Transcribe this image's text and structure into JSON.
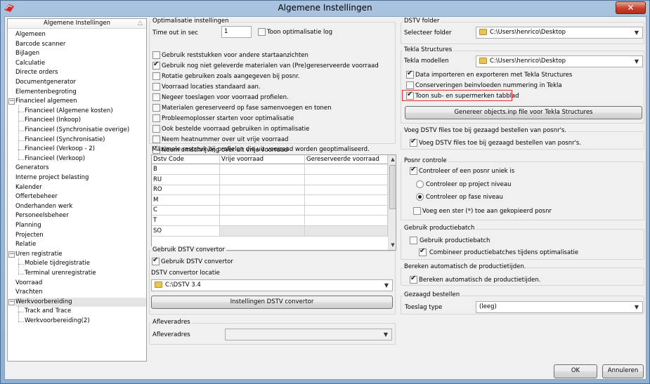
{
  "window": {
    "title": "Algemene Instellingen",
    "close": "✕"
  },
  "tree": {
    "header": "Algemene Instellingen",
    "items": [
      {
        "label": "Algemeen"
      },
      {
        "label": "Barcode scanner"
      },
      {
        "label": "Bijlagen"
      },
      {
        "label": "Calculatie"
      },
      {
        "label": "Directe orders"
      },
      {
        "label": "Documentgenerator"
      },
      {
        "label": "Elementenbegroting"
      },
      {
        "label": "Financieel algemeen"
      },
      {
        "label": "Financieel (Algemene kosten)"
      },
      {
        "label": "Financieel (Inkoop)"
      },
      {
        "label": "Financieel (Synchronisatie overige)"
      },
      {
        "label": "Financieel (Synchronisatie)"
      },
      {
        "label": "Financieel (Verkoop - 2)"
      },
      {
        "label": "Financieel (Verkoop)"
      },
      {
        "label": "Generators"
      },
      {
        "label": "Interne project belasting"
      },
      {
        "label": "Kalender"
      },
      {
        "label": "Offertebeheer"
      },
      {
        "label": "Onderhanden werk"
      },
      {
        "label": "Personeelsbeheer"
      },
      {
        "label": "Planning"
      },
      {
        "label": "Projecten"
      },
      {
        "label": "Relatie"
      },
      {
        "label": "Uren registratie"
      },
      {
        "label": "Mobiele tijdregistratie"
      },
      {
        "label": "Terminal urenregistratie"
      },
      {
        "label": "Voorraad"
      },
      {
        "label": "Vrachten"
      },
      {
        "label": "Werkvoorbereiding"
      },
      {
        "label": "Track and Trace"
      },
      {
        "label": "Werkvoorbereiding(2)"
      }
    ]
  },
  "opt": {
    "group": "Optimalisatie instellingen",
    "timeout_label": "Time out in sec",
    "timeout_value": "1",
    "log_label": "Toon optimalisatie log",
    "checks": [
      {
        "label": "Gebruik reststukken voor andere startaanzichten",
        "checked": false
      },
      {
        "label": "Gebruik nog niet geleverde materialen van (Pre)gereserveerde voorraad",
        "checked": true
      },
      {
        "label": "Rotatie gebruiken zoals aangegeven bij posnr.",
        "checked": false
      },
      {
        "label": "Voorraad locaties standaard aan.",
        "checked": false
      },
      {
        "label": "Negeer toeslagen voor voorraad profielen.",
        "checked": false
      },
      {
        "label": "Materialen gereserveerd op fase samenvoegen en tonen",
        "checked": false
      },
      {
        "label": "Probleemoplosser starten voor optimalisatie",
        "checked": false
      },
      {
        "label": "Ook bestelde voorraad gebruiken in optimalisatie",
        "checked": false
      },
      {
        "label": "Neem heatnummer over uit vrije voorraad",
        "checked": false
      },
      {
        "label": "Neem omschrijving over uit vrije voorraad",
        "checked": false
      }
    ]
  },
  "grid": {
    "title": "Maximale reststuk bij profielen die uit voorraad worden geoptimaliseerd.",
    "columns": [
      "Dstv Code",
      "Vrije voorraad",
      "Gereserveerde voorraad"
    ],
    "rows": [
      "B",
      "RU",
      "RO",
      "M",
      "C",
      "T",
      "SO"
    ]
  },
  "dstvconv": {
    "group": "Gebruik DSTV convertor",
    "use_label": "Gebruik DSTV convertor",
    "loc_label": "DSTV convertor locatie",
    "loc_value": "C:\\DSTV 3.4",
    "button": "Instellingen DSTV convertor"
  },
  "afl": {
    "group": "Afleveradres",
    "label": "Afleveradres",
    "value": ""
  },
  "dstvfolder": {
    "group": "DSTV folder",
    "label": "Selecteer folder",
    "value": "C:\\Users\\henrico\\Desktop"
  },
  "tekla": {
    "group": "Tekla Structures",
    "label": "Tekla modellen",
    "value": "C:\\Users\\henrico\\Desktop",
    "checks": [
      {
        "label": "Data importeren en exporteren met Tekla Structures",
        "checked": true
      },
      {
        "label": "Conserveringen beinvloeden nummering in Tekla",
        "checked": false
      },
      {
        "label": "Toon sub- en supermerken tabblad",
        "checked": true
      }
    ],
    "button": "Genereer objects.inp file voor Tekla Structures"
  },
  "voeg": {
    "group": "Voeg DSTV files toe bij gezaagd bestellen van posnr's.",
    "label": "Voeg DSTV files toe bij gezaagd bestellen van posnr's."
  },
  "posnr": {
    "group": "Posnr controle",
    "check": "Controleer of een posnr uniek is",
    "radio1": "Controleer op project niveau",
    "radio2": "Controleer op fase niveau",
    "star": "Voeg een ster (*) toe aan gekopieerd posnr"
  },
  "batch": {
    "group": "Gebruik productiebatch",
    "check1": "Gebruik productiebatch",
    "check2": "Combineer productiebatches tijdens optimalisatie"
  },
  "prodtijd": {
    "group": "Bereken automatisch de productietijden.",
    "label": "Bereken automatisch de productietijden."
  },
  "gezaagd": {
    "group": "Gezaagd bestellen",
    "label": "Toeslag type",
    "value": "(leeg)"
  },
  "footer": {
    "ok": "OK",
    "cancel": "Annuleren"
  },
  "colors": {
    "highlight": "#e03030",
    "title_bg": "#a9c3df",
    "close_bg": "#c7402a"
  }
}
